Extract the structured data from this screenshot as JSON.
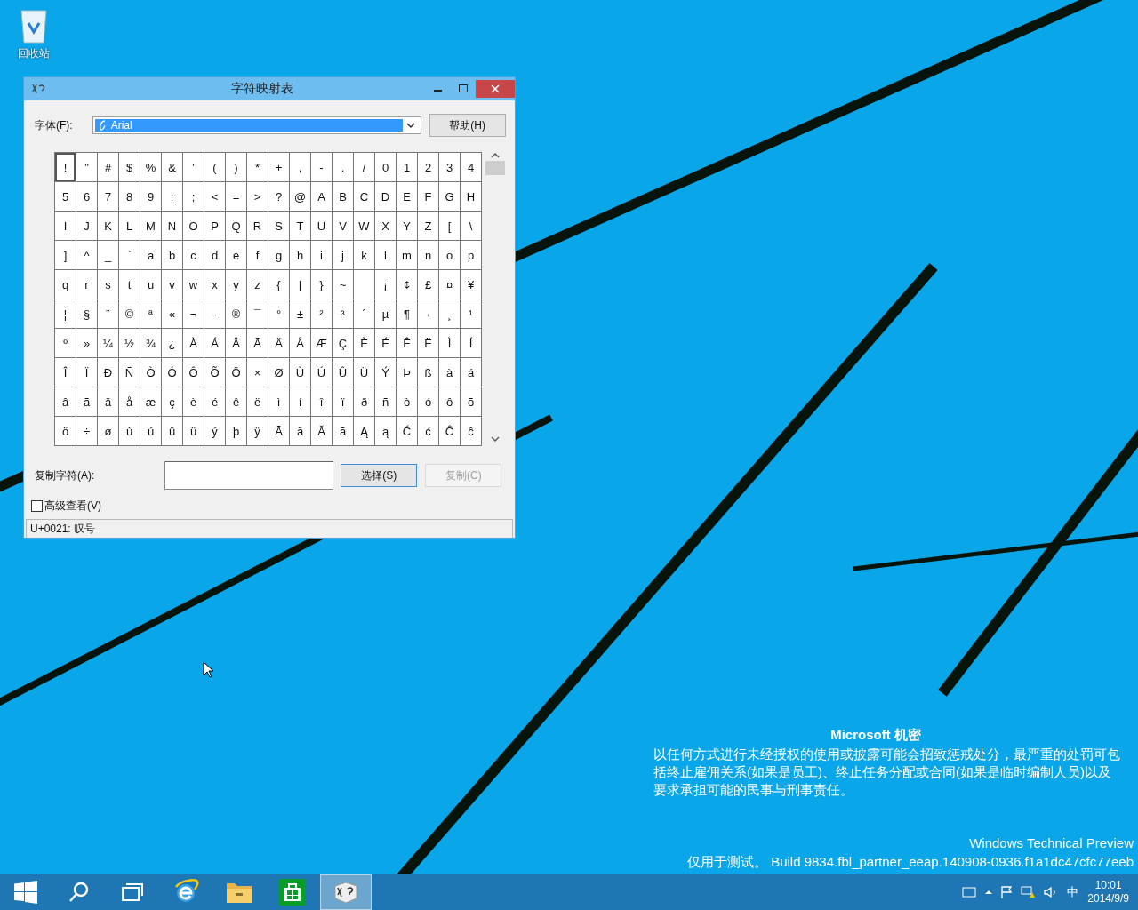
{
  "desktop": {
    "icons": [
      {
        "label": "回收站"
      }
    ]
  },
  "window": {
    "title": "字符映射表",
    "font_label": "字体(F):",
    "font_value": "Arial",
    "help_button": "帮助(H)",
    "grid": {
      "rows": [
        [
          {
            "c": "!",
            "selected": true
          },
          {
            "c": "\"",
            "selected": false
          },
          {
            "c": "#",
            "selected": false
          },
          {
            "c": "$",
            "selected": false
          },
          {
            "c": "%",
            "selected": false
          },
          {
            "c": "&",
            "selected": false
          },
          {
            "c": "'",
            "selected": false
          },
          {
            "c": "(",
            "selected": false
          },
          {
            "c": ")",
            "selected": false
          },
          {
            "c": "*",
            "selected": false
          },
          {
            "c": "+",
            "selected": false
          },
          {
            "c": ",",
            "selected": false
          },
          {
            "c": "-",
            "selected": false
          },
          {
            "c": ".",
            "selected": false
          },
          {
            "c": "/",
            "selected": false
          },
          {
            "c": "0",
            "selected": false
          },
          {
            "c": "1",
            "selected": false
          },
          {
            "c": "2",
            "selected": false
          },
          {
            "c": "3",
            "selected": false
          },
          {
            "c": "4",
            "selected": false
          }
        ],
        [
          {
            "c": "5",
            "selected": false
          },
          {
            "c": "6",
            "selected": false
          },
          {
            "c": "7",
            "selected": false
          },
          {
            "c": "8",
            "selected": false
          },
          {
            "c": "9",
            "selected": false
          },
          {
            "c": ":",
            "selected": false
          },
          {
            "c": ";",
            "selected": false
          },
          {
            "c": "<",
            "selected": false
          },
          {
            "c": "=",
            "selected": false
          },
          {
            "c": ">",
            "selected": false
          },
          {
            "c": "?",
            "selected": false
          },
          {
            "c": "@",
            "selected": false
          },
          {
            "c": "A",
            "selected": false
          },
          {
            "c": "B",
            "selected": false
          },
          {
            "c": "C",
            "selected": false
          },
          {
            "c": "D",
            "selected": false
          },
          {
            "c": "E",
            "selected": false
          },
          {
            "c": "F",
            "selected": false
          },
          {
            "c": "G",
            "selected": false
          },
          {
            "c": "H",
            "selected": false
          }
        ],
        [
          {
            "c": "I",
            "selected": false
          },
          {
            "c": "J",
            "selected": false
          },
          {
            "c": "K",
            "selected": false
          },
          {
            "c": "L",
            "selected": false
          },
          {
            "c": "M",
            "selected": false
          },
          {
            "c": "N",
            "selected": false
          },
          {
            "c": "O",
            "selected": false
          },
          {
            "c": "P",
            "selected": false
          },
          {
            "c": "Q",
            "selected": false
          },
          {
            "c": "R",
            "selected": false
          },
          {
            "c": "S",
            "selected": false
          },
          {
            "c": "T",
            "selected": false
          },
          {
            "c": "U",
            "selected": false
          },
          {
            "c": "V",
            "selected": false
          },
          {
            "c": "W",
            "selected": false
          },
          {
            "c": "X",
            "selected": false
          },
          {
            "c": "Y",
            "selected": false
          },
          {
            "c": "Z",
            "selected": false
          },
          {
            "c": "[",
            "selected": false
          },
          {
            "c": "\\",
            "selected": false
          }
        ],
        [
          {
            "c": "]",
            "selected": false
          },
          {
            "c": "^",
            "selected": false
          },
          {
            "c": "_",
            "selected": false
          },
          {
            "c": "`",
            "selected": false
          },
          {
            "c": "a",
            "selected": false
          },
          {
            "c": "b",
            "selected": false
          },
          {
            "c": "c",
            "selected": false
          },
          {
            "c": "d",
            "selected": false
          },
          {
            "c": "e",
            "selected": false
          },
          {
            "c": "f",
            "selected": false
          },
          {
            "c": "g",
            "selected": false
          },
          {
            "c": "h",
            "selected": false
          },
          {
            "c": "i",
            "selected": false
          },
          {
            "c": "j",
            "selected": false
          },
          {
            "c": "k",
            "selected": false
          },
          {
            "c": "l",
            "selected": false
          },
          {
            "c": "m",
            "selected": false
          },
          {
            "c": "n",
            "selected": false
          },
          {
            "c": "o",
            "selected": false
          },
          {
            "c": "p",
            "selected": false
          }
        ],
        [
          {
            "c": "q",
            "selected": false
          },
          {
            "c": "r",
            "selected": false
          },
          {
            "c": "s",
            "selected": false
          },
          {
            "c": "t",
            "selected": false
          },
          {
            "c": "u",
            "selected": false
          },
          {
            "c": "v",
            "selected": false
          },
          {
            "c": "w",
            "selected": false
          },
          {
            "c": "x",
            "selected": false
          },
          {
            "c": "y",
            "selected": false
          },
          {
            "c": "z",
            "selected": false
          },
          {
            "c": "{",
            "selected": false
          },
          {
            "c": "|",
            "selected": false
          },
          {
            "c": "}",
            "selected": false
          },
          {
            "c": "~",
            "selected": false
          },
          {
            "selected": false
          },
          {
            "c": "¡",
            "selected": false
          },
          {
            "c": "¢",
            "selected": false
          },
          {
            "c": "£",
            "selected": false
          },
          {
            "c": "¤",
            "selected": false
          },
          {
            "c": "¥",
            "selected": false
          }
        ],
        [
          {
            "c": "¦",
            "selected": false
          },
          {
            "c": "§",
            "selected": false
          },
          {
            "c": "¨",
            "selected": false
          },
          {
            "c": "©",
            "selected": false
          },
          {
            "c": "ª",
            "selected": false
          },
          {
            "c": "«",
            "selected": false
          },
          {
            "c": "¬",
            "selected": false
          },
          {
            "c": "-",
            "selected": false
          },
          {
            "c": "®",
            "selected": false
          },
          {
            "c": "¯",
            "selected": false
          },
          {
            "c": "°",
            "selected": false
          },
          {
            "c": "±",
            "selected": false
          },
          {
            "c": "²",
            "selected": false
          },
          {
            "c": "³",
            "selected": false
          },
          {
            "c": "´",
            "selected": false
          },
          {
            "c": "µ",
            "selected": false
          },
          {
            "c": "¶",
            "selected": false
          },
          {
            "c": "·",
            "selected": false
          },
          {
            "c": "¸",
            "selected": false
          },
          {
            "c": "¹",
            "selected": false
          }
        ],
        [
          {
            "c": "º",
            "selected": false
          },
          {
            "c": "»",
            "selected": false
          },
          {
            "c": "¼",
            "selected": false
          },
          {
            "c": "½",
            "selected": false
          },
          {
            "c": "¾",
            "selected": false
          },
          {
            "c": "¿",
            "selected": false
          },
          {
            "c": "À",
            "selected": false
          },
          {
            "c": "Á",
            "selected": false
          },
          {
            "c": "Â",
            "selected": false
          },
          {
            "c": "Ã",
            "selected": false
          },
          {
            "c": "Ä",
            "selected": false
          },
          {
            "c": "Å",
            "selected": false
          },
          {
            "c": "Æ",
            "selected": false
          },
          {
            "c": "Ç",
            "selected": false
          },
          {
            "c": "È",
            "selected": false
          },
          {
            "c": "É",
            "selected": false
          },
          {
            "c": "Ê",
            "selected": false
          },
          {
            "c": "Ë",
            "selected": false
          },
          {
            "c": "Ì",
            "selected": false
          },
          {
            "c": "Í",
            "selected": false
          }
        ],
        [
          {
            "c": "Î",
            "selected": false
          },
          {
            "c": "Ï",
            "selected": false
          },
          {
            "c": "Ð",
            "selected": false
          },
          {
            "c": "Ñ",
            "selected": false
          },
          {
            "c": "Ò",
            "selected": false
          },
          {
            "c": "Ó",
            "selected": false
          },
          {
            "c": "Ô",
            "selected": false
          },
          {
            "c": "Õ",
            "selected": false
          },
          {
            "c": "Ö",
            "selected": false
          },
          {
            "c": "×",
            "selected": false
          },
          {
            "c": "Ø",
            "selected": false
          },
          {
            "c": "Ù",
            "selected": false
          },
          {
            "c": "Ú",
            "selected": false
          },
          {
            "c": "Û",
            "selected": false
          },
          {
            "c": "Ü",
            "selected": false
          },
          {
            "c": "Ý",
            "selected": false
          },
          {
            "c": "Þ",
            "selected": false
          },
          {
            "c": "ß",
            "selected": false
          },
          {
            "c": "à",
            "selected": false
          },
          {
            "c": "á",
            "selected": false
          }
        ],
        [
          {
            "c": "â",
            "selected": false
          },
          {
            "c": "ã",
            "selected": false
          },
          {
            "c": "ä",
            "selected": false
          },
          {
            "c": "å",
            "selected": false
          },
          {
            "c": "æ",
            "selected": false
          },
          {
            "c": "ç",
            "selected": false
          },
          {
            "c": "è",
            "selected": false
          },
          {
            "c": "é",
            "selected": false
          },
          {
            "c": "ê",
            "selected": false
          },
          {
            "c": "ë",
            "selected": false
          },
          {
            "c": "ì",
            "selected": false
          },
          {
            "c": "í",
            "selected": false
          },
          {
            "c": "î",
            "selected": false
          },
          {
            "c": "ï",
            "selected": false
          },
          {
            "c": "ð",
            "selected": false
          },
          {
            "c": "ñ",
            "selected": false
          },
          {
            "c": "ò",
            "selected": false
          },
          {
            "c": "ó",
            "selected": false
          },
          {
            "c": "ô",
            "selected": false
          },
          {
            "c": "õ",
            "selected": false
          }
        ],
        [
          {
            "c": "ö",
            "selected": false
          },
          {
            "c": "÷",
            "selected": false
          },
          {
            "c": "ø",
            "selected": false
          },
          {
            "c": "ù",
            "selected": false
          },
          {
            "c": "ú",
            "selected": false
          },
          {
            "c": "û",
            "selected": false
          },
          {
            "c": "ü",
            "selected": false
          },
          {
            "c": "ý",
            "selected": false
          },
          {
            "c": "þ",
            "selected": false
          },
          {
            "c": "ÿ",
            "selected": false
          },
          {
            "c": "Ā",
            "selected": false
          },
          {
            "c": "ā",
            "selected": false
          },
          {
            "c": "Ă",
            "selected": false
          },
          {
            "c": "ă",
            "selected": false
          },
          {
            "c": "Ą",
            "selected": false
          },
          {
            "c": "ą",
            "selected": false
          },
          {
            "c": "Ć",
            "selected": false
          },
          {
            "c": "ć",
            "selected": false
          },
          {
            "c": "Ĉ",
            "selected": false
          },
          {
            "c": "ĉ",
            "selected": false
          }
        ]
      ]
    },
    "copy_label": "复制字符(A):",
    "select_button": "选择(S)",
    "copy_button": {
      "label": "复制(C)",
      "disabled": true
    },
    "advanced": {
      "label": "高级查看(V)",
      "checked": false
    },
    "status": "U+0021: 叹号"
  },
  "notice": {
    "title": "Microsoft 机密",
    "body": "以任何方式进行未经授权的使用或披露可能会招致惩戒处分，最严重的处罚可包括终止雇佣关系(如果是员工)、终止任务分配或合同(如果是临时编制人员)以及要求承担可能的民事与刑事责任。",
    "edition": "Windows Technical Preview",
    "build": "仅用于测试。 Build 9834.fbl_partner_eeap.140908-0936.f1a1dc47cfc77eeb"
  },
  "taskbar": {
    "apps": [
      {
        "kind": "start",
        "selected": false
      },
      {
        "kind": "search",
        "selected": false
      },
      {
        "kind": "taskview",
        "selected": false
      },
      {
        "kind": "browser",
        "selected": false
      },
      {
        "kind": "explorer",
        "selected": false
      },
      {
        "kind": "store",
        "selected": false
      },
      {
        "kind": "charmap",
        "selected": true
      }
    ],
    "language": "中",
    "time": "10:01",
    "date": "2014/9/9"
  }
}
